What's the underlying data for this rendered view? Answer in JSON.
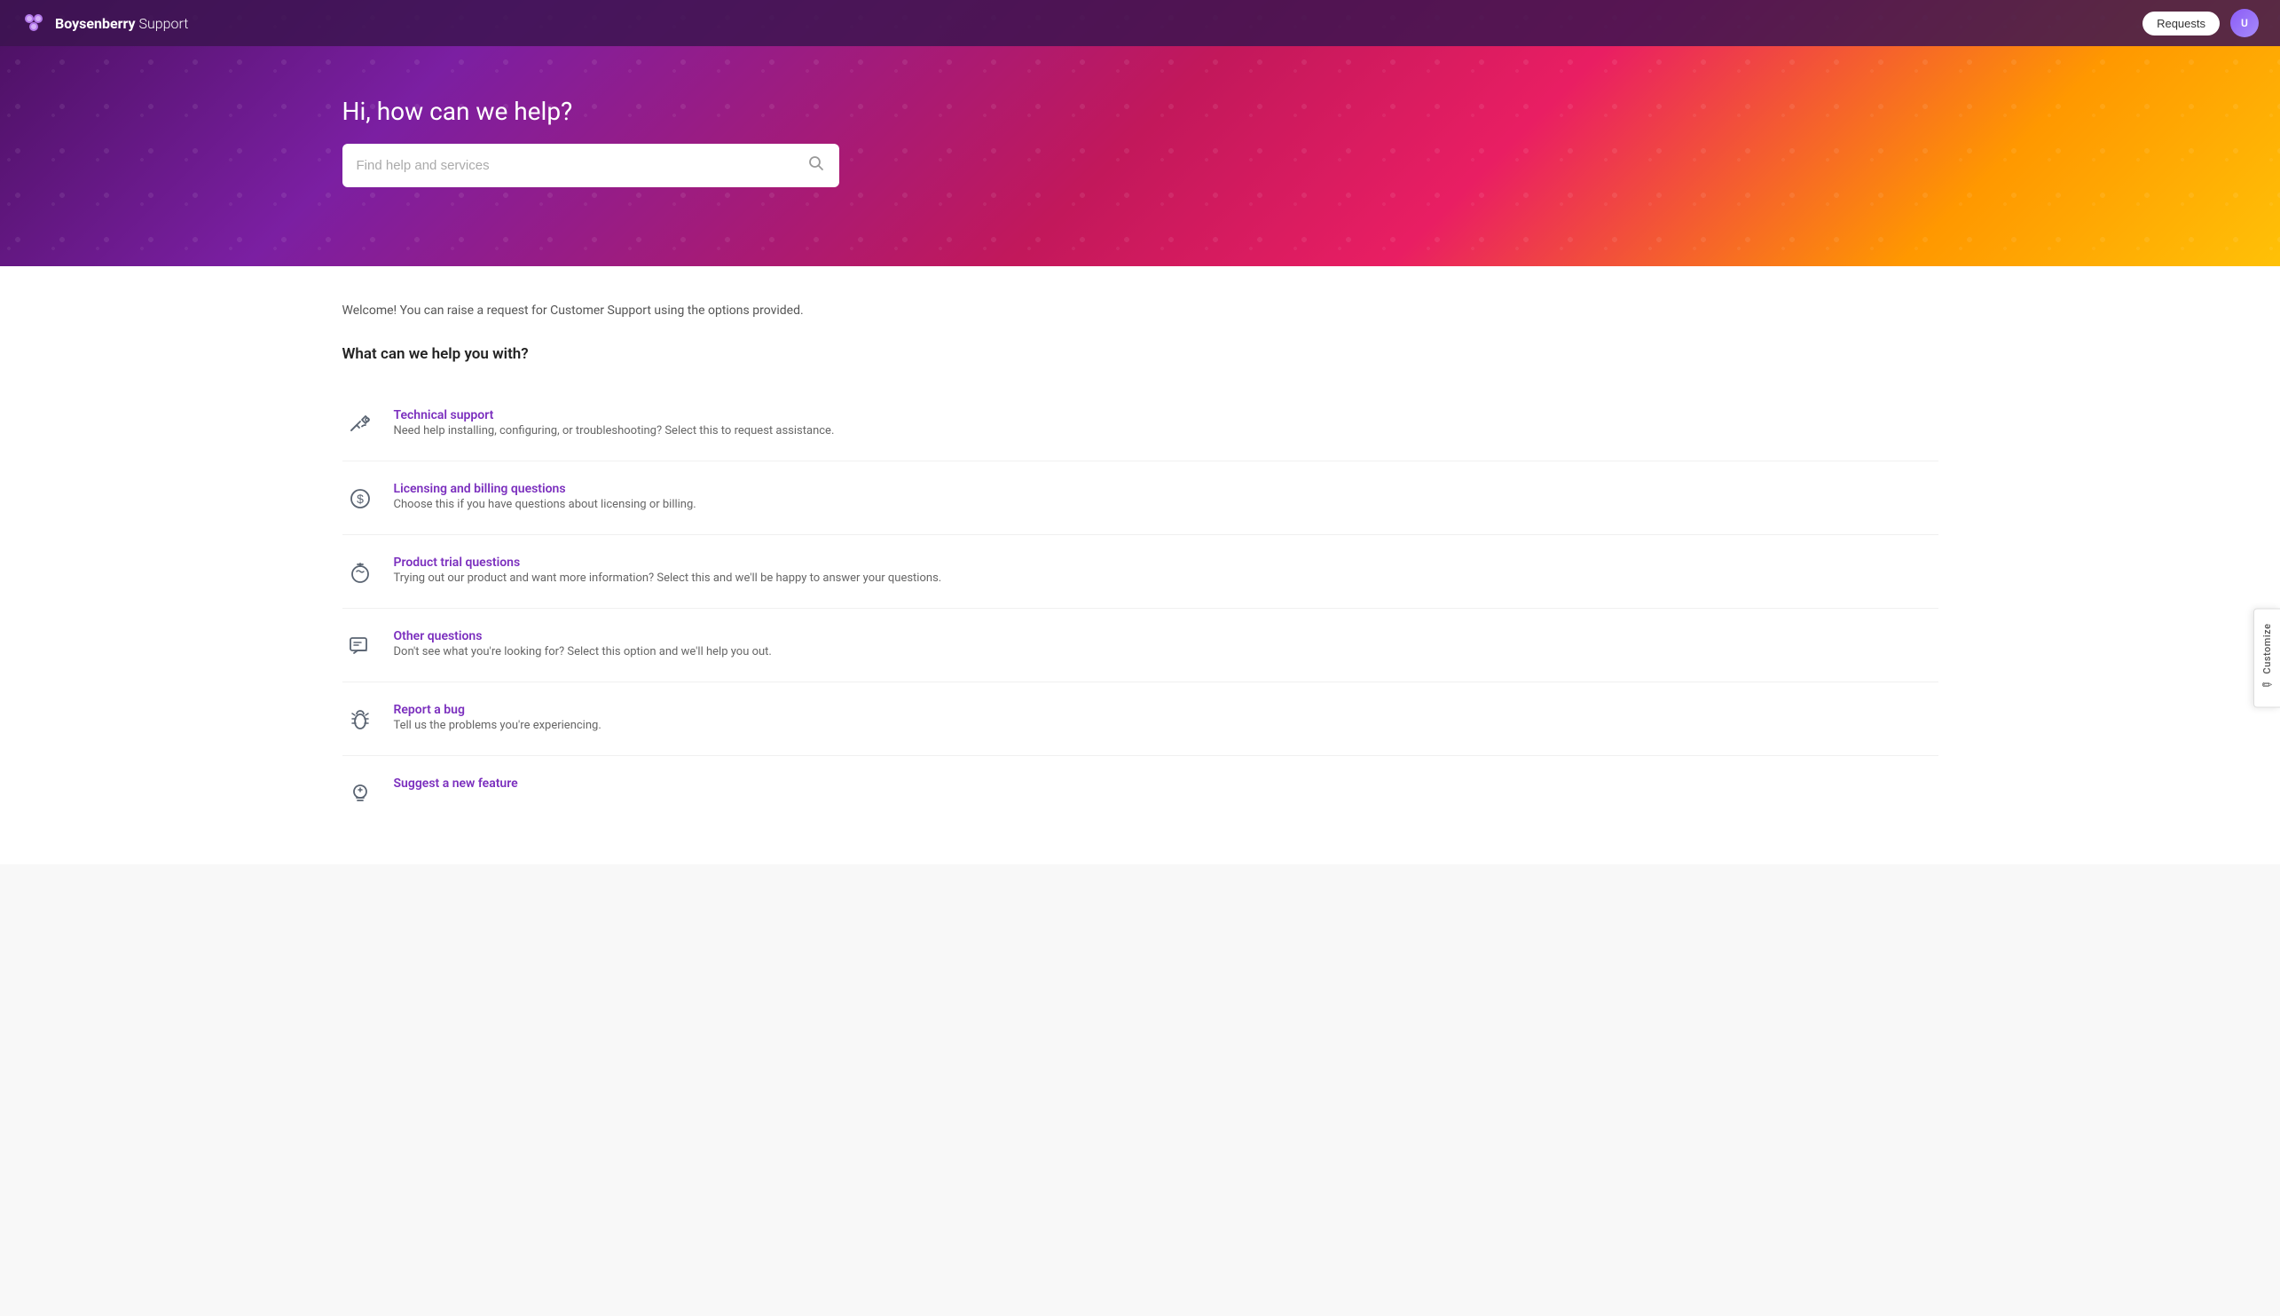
{
  "header": {
    "brand_name": "Boysenberry",
    "brand_suffix": " Support",
    "requests_label": "Requests",
    "avatar_initials": "U"
  },
  "hero": {
    "title": "Hi, how can we help?",
    "search_placeholder": "Find help and services"
  },
  "customize_tab": {
    "label": "Customize",
    "icon": "✏"
  },
  "main": {
    "welcome_text": "Welcome! You can raise a request for Customer Support using the options provided.",
    "section_title": "What can we help you with?",
    "services": [
      {
        "name": "Technical support",
        "description": "Need help installing, configuring, or troubleshooting? Select this to request assistance.",
        "icon": "technical"
      },
      {
        "name": "Licensing and billing questions",
        "description": "Choose this if you have questions about licensing or billing.",
        "icon": "billing"
      },
      {
        "name": "Product trial questions",
        "description": "Trying out our product and want more information? Select this and we'll be happy to answer your questions.",
        "icon": "trial"
      },
      {
        "name": "Other questions",
        "description": "Don't see what you're looking for? Select this option and we'll help you out.",
        "icon": "other"
      },
      {
        "name": "Report a bug",
        "description": "Tell us the problems you're experiencing.",
        "icon": "bug"
      },
      {
        "name": "Suggest a new feature",
        "description": "",
        "icon": "feature"
      }
    ]
  }
}
